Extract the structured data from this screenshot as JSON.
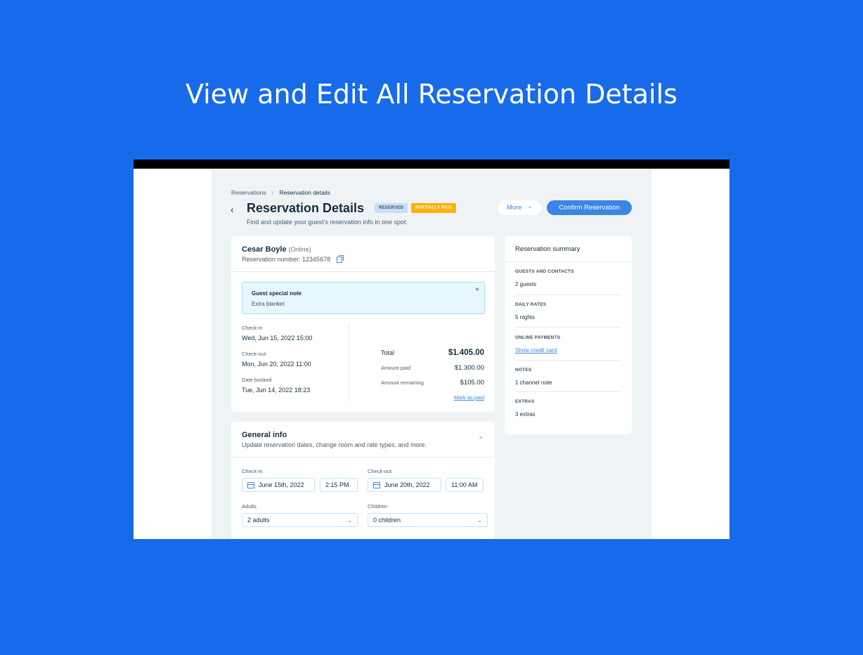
{
  "hero": {
    "title": "View and Edit All Reservation Details"
  },
  "breadcrumb": {
    "parent": "Reservations",
    "separator": "›",
    "current": "Reservation details"
  },
  "header": {
    "back": "‹",
    "title": "Reservation Details",
    "badges": {
      "reserved": "RESERVED",
      "partially_paid": "PARTIALLY PAID"
    },
    "subtitle": "Find and update your guest’s reservation info in one spot.",
    "more_label": "More",
    "more_chevron": "⌄",
    "confirm_label": "Confirm Reservation"
  },
  "guest": {
    "name": "Cesar Boyle",
    "source": "(Online)",
    "reservation_number": "Reservation number: 12345678",
    "note": {
      "title": "Guest special note",
      "text": "Extra blanket",
      "close": "×"
    },
    "dates": [
      {
        "label": "Check-in",
        "value": "Wed, Jun 15, 2022 15:00"
      },
      {
        "label": "Check-out",
        "value": "Mon, Jun 20, 2022 11:00"
      },
      {
        "label": "Date booked",
        "value": "Tue, Jun 14, 2022 18:23"
      }
    ],
    "totals": {
      "total_label": "Total",
      "total_value": "$1.405.00",
      "paid_label": "Amount paid",
      "paid_value": "$1.300.00",
      "remaining_label": "Amount remaining",
      "remaining_value": "$105.00",
      "mark_paid": "Mark as paid"
    }
  },
  "general": {
    "title": "General info",
    "subtitle": "Update reservation dates, change room and rate types, and more.",
    "chevron": "⌃",
    "checkin_label": "Check-in",
    "checkin_date": "June 15th, 2022",
    "checkin_time": "2:15 PM",
    "checkout_label": "Check-out",
    "checkout_date": "June 20th, 2022",
    "checkout_time": "11:00 AM",
    "adults_label": "Adults",
    "adults_value": "2 adults",
    "children_label": "Children",
    "children_value": "0 children",
    "select_chevron": "⌄"
  },
  "summary": {
    "title": "Reservation summary",
    "sections": [
      {
        "head": "GUESTS AND CONTACTS",
        "value": "2 guests"
      },
      {
        "head": "DAILY RATES",
        "value": "5 nights"
      },
      {
        "head": "ONLINE PAYMENTS",
        "value": "Show credit card"
      },
      {
        "head": "NOTES",
        "value": "1 channel note"
      },
      {
        "head": "EXTRAS",
        "value": "3 extras"
      }
    ]
  },
  "colors": {
    "background": "#176bea",
    "accent": "#3b86e4",
    "canvas": "#eff3f6",
    "badge_paid": "#fdb10c",
    "badge_reserved": "#c9ddf5"
  }
}
